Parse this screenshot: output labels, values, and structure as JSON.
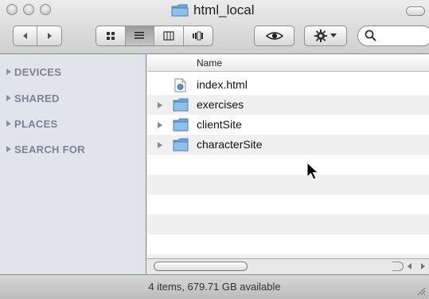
{
  "window": {
    "title": "html_local"
  },
  "toolbar": {
    "nav_back_icon": "back-arrow-icon",
    "nav_forward_icon": "forward-arrow-icon",
    "view_icons": [
      "icon-view-icon",
      "list-view-icon",
      "column-view-icon",
      "coverflow-view-icon"
    ],
    "active_view": "list",
    "quicklook_icon": "eye-icon",
    "action_icon": "gear-icon",
    "search": {
      "value": "",
      "placeholder": ""
    }
  },
  "sidebar": {
    "items": [
      {
        "label": "DEVICES"
      },
      {
        "label": "SHARED"
      },
      {
        "label": "PLACES"
      },
      {
        "label": "SEARCH FOR"
      }
    ]
  },
  "list": {
    "column_header": "Name",
    "rows": [
      {
        "name": "index.html",
        "type": "file",
        "icon": "html-file-icon"
      },
      {
        "name": "exercises",
        "type": "folder",
        "icon": "folder-icon"
      },
      {
        "name": "clientSite",
        "type": "folder",
        "icon": "folder-icon"
      },
      {
        "name": "characterSite",
        "type": "folder",
        "icon": "folder-icon"
      }
    ]
  },
  "status_bar": {
    "text": "4 items, 679.71 GB available"
  },
  "colors": {
    "sidebar_bg": "#e1e5eb",
    "sidebar_text": "#7a8390",
    "folder_blue": "#7fb3e0",
    "row_stripe": "#f0f0f0"
  }
}
